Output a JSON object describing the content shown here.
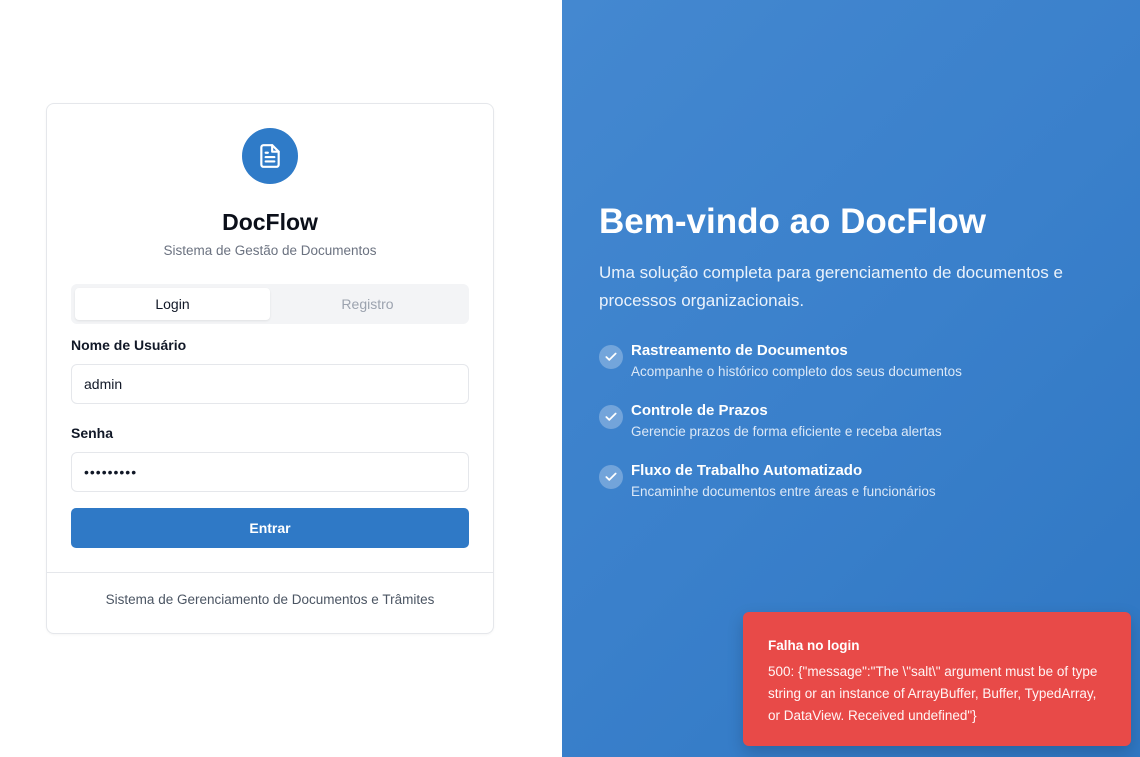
{
  "app": {
    "name": "DocFlow",
    "subtitle": "Sistema de Gestão de Documentos",
    "accent_color": "#2f7bc8",
    "logo_icon": "document-icon"
  },
  "auth_tabs": [
    {
      "label": "Login",
      "active": true
    },
    {
      "label": "Registro",
      "active": false
    }
  ],
  "form": {
    "username_label": "Nome de Usuário",
    "username_value": "admin",
    "password_label": "Senha",
    "password_value": "•••••••••",
    "submit_label": "Entrar"
  },
  "card_footer": "Sistema de Gerenciamento de Documentos e Trâmites",
  "hero": {
    "title": "Bem-vindo ao DocFlow",
    "description": "Uma solução completa para gerenciamento de documentos e processos organizacionais.",
    "background_color": "#3a80cb",
    "features": [
      {
        "title": "Rastreamento de Documentos",
        "description": "Acompanhe o histórico completo dos seus documentos",
        "icon": "check-circle-icon"
      },
      {
        "title": "Controle de Prazos",
        "description": "Gerencie prazos de forma eficiente e receba alertas",
        "icon": "check-circle-icon"
      },
      {
        "title": "Fluxo de Trabalho Automatizado",
        "description": "Encaminhe documentos entre áreas e funcionários",
        "icon": "check-circle-icon"
      }
    ]
  },
  "toast": {
    "title": "Falha no login",
    "message": "500: {\"message\":\"The \\\"salt\\\" argument must be of type string or an instance of ArrayBuffer, Buffer, TypedArray, or DataView. Received undefined\"}",
    "color": "#e84a48"
  }
}
